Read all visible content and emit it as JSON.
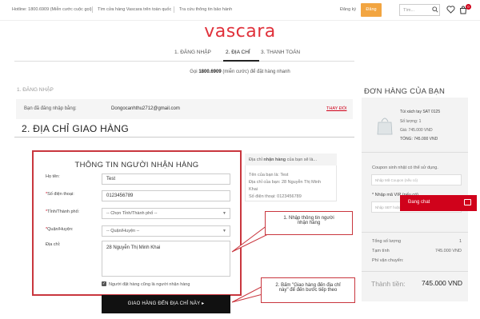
{
  "topbar": {
    "hotline": "Hotline: 1800.6909 (Miễn cước cuộc gọi)",
    "find_store": "Tìm cửa hàng Vascara trên toàn quốc",
    "warranty": "Tra cứu thông tin bảo hành",
    "register": "Đăng ký",
    "login": "Đăng nhập",
    "search_placeholder": "Tìm...",
    "cart_count": "0"
  },
  "logo": "vascara",
  "steps": {
    "step1": "1. ĐĂNG NHẬP",
    "step2": "2. ĐỊA CHỈ",
    "step3": "3. THANH TOÁN"
  },
  "hotline_notice": {
    "prefix": "Gọi ",
    "number": "1800.6909",
    "suffix": " (miễn cước) để đặt hàng nhanh"
  },
  "login_section": {
    "title": "1. ĐĂNG NHẬP",
    "label": "Bạn đã đăng nhập bằng:",
    "email": "Dongocanhthu2712@gmail.com",
    "change": "THAY ĐỔI"
  },
  "shipping": {
    "title": "2. ĐỊA CHỈ GIAO HÀNG",
    "form_title": "THÔNG TIN NGƯỜI NHẬN HÀNG",
    "name_label": "Họ tên:",
    "name_value": "Test",
    "phone_label": "Số điện thoại:",
    "phone_value": "0123456789",
    "city_label": "Tỉnh/Thành phố:",
    "city_value": "-- Chọn Tỉnh/Thành phố --",
    "district_label": "Quận/Huyện:",
    "district_value": "-- Quận/Huyện --",
    "address_label": "Địa chỉ:",
    "address_value": "28 Nguyễn Thị Minh Khai",
    "same_person": "Người đặt hàng cũng là người nhận hàng",
    "submit": "GIAO HÀNG ĐẾN ĐỊA CHỈ NÀY ▸"
  },
  "preview": {
    "head_prefix": "Địa chỉ ",
    "head_bold": "nhận hàng",
    "head_suffix": " của bạn sẽ là...",
    "name_line": "Tên của bạn là: Test",
    "address_line1": "Địa chỉ của bạn: 28 Nguyễn Thị Minh",
    "address_line2": "Khai",
    "phone_line": "Số điện thoại: 0123456789"
  },
  "callouts": {
    "one_line1": "1. Nhập thông tin người",
    "one_line2": "nhận hàng",
    "two_line1": "2. Bấm \"Giao hàng đến địa chỉ",
    "two_line2": "này\" để đến bước tiếp theo"
  },
  "order": {
    "title": "ĐƠN HÀNG CỦA BẠN",
    "product_name": "Túi xách tay SAT 0125",
    "quantity": "Số lượng: 1",
    "price": "Giá: 745.000 VND",
    "subtotal": "TỔNG: 745.000 VND",
    "coupon_label": "Coupon sinh nhật có thể sử dụng.",
    "coupon_placeholder": "Nhập Mã Coupon (nếu có)",
    "vip_label": "* Nhập mã VIP (nếu có)",
    "vip_placeholder": "Nhập SĐT hoặc Email của bạn",
    "qty_label": "Tổng số lượng",
    "qty_value": "1",
    "temp_label": "Tạm tính",
    "temp_value": "745.000 VND",
    "ship_label": "Phí vận chuyển:",
    "total_label": "Thành tiền:",
    "total_value": "745.000 VND"
  },
  "chat": {
    "label": "Đang chat"
  },
  "colors": {
    "brand_red": "#e0313b",
    "accent_orange": "#f2a541",
    "callout_border": "#c9363e"
  }
}
